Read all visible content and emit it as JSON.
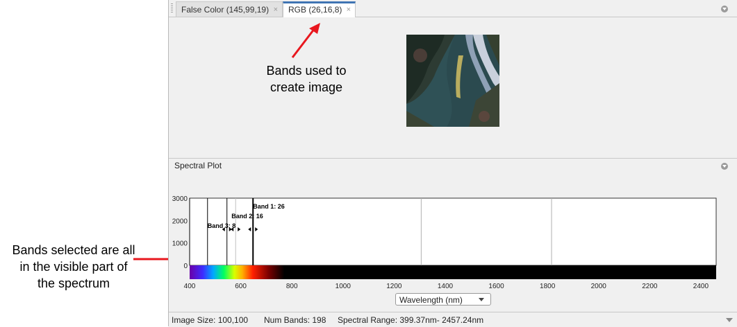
{
  "tabs": [
    {
      "label": "False Color (145,99,19)",
      "close": "×"
    },
    {
      "label": "RGB (26,16,8)",
      "close": "×"
    }
  ],
  "annotations": {
    "top_lines": [
      "Bands used to",
      "create image"
    ],
    "left_lines": [
      "Bands selected are all",
      "in the visible part of",
      "the spectrum"
    ],
    "arrow_color": "#e8171e"
  },
  "spectral_panel": {
    "title": "Spectral Plot",
    "axis_selector": "Wavelength (nm)"
  },
  "chart_data": {
    "type": "line",
    "x_range": [
      400,
      2460
    ],
    "ylim": [
      0,
      3000
    ],
    "y_ticks": [
      "0",
      "1000",
      "2000",
      "3000"
    ],
    "x_ticks": [
      "400",
      "600",
      "800",
      "1000",
      "1200",
      "1400",
      "1600",
      "1800",
      "2000",
      "2200",
      "2400"
    ],
    "x_tick_values": [
      400,
      600,
      800,
      1000,
      1200,
      1400,
      1600,
      1800,
      2000,
      2200,
      2400
    ],
    "band_edges": [
      400,
      470,
      546,
      648
    ],
    "grid_lines": [
      1306,
      1816
    ],
    "bands": [
      {
        "label": "Band 3: 8",
        "wavelength": 546
      },
      {
        "label": "Band 2: 16",
        "wavelength": 580
      },
      {
        "label": "Band 1: 26",
        "wavelength": 648
      }
    ]
  },
  "status": {
    "image_size": "Image Size: 100,100",
    "num_bands": "Num Bands: 198",
    "spectral_range": "Spectral Range: 399.37nm- 2457.24nm"
  }
}
